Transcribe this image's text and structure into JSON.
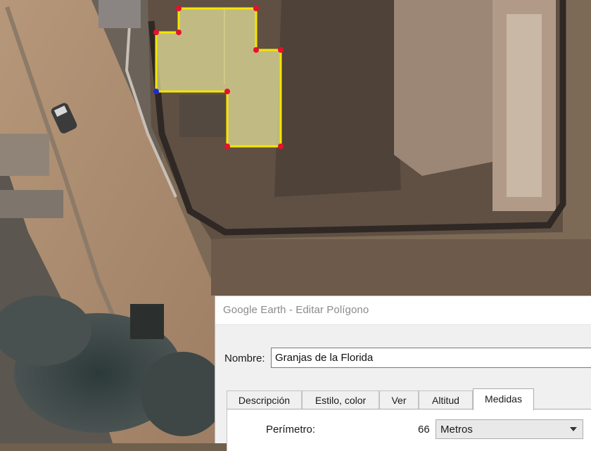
{
  "dialog": {
    "title": "Google Earth - Editar Polígono",
    "name_label": "Nombre:",
    "name_value": "Granjas de la Florida",
    "tabs": [
      {
        "label": "Descripción"
      },
      {
        "label": "Estilo, color"
      },
      {
        "label": "Ver"
      },
      {
        "label": "Altitud"
      },
      {
        "label": "Medidas",
        "active": true
      }
    ],
    "perimeter_label": "Perímetro:",
    "perimeter_value": "66",
    "units_value": "Metros"
  },
  "colors": {
    "polygon_outline": "#f5e600",
    "polygon_fill": "#e8e59c",
    "vertex": "#e8102a",
    "vertex_selected": "#1e2bd8"
  },
  "icons": [
    "dropdown-arrow-icon"
  ]
}
